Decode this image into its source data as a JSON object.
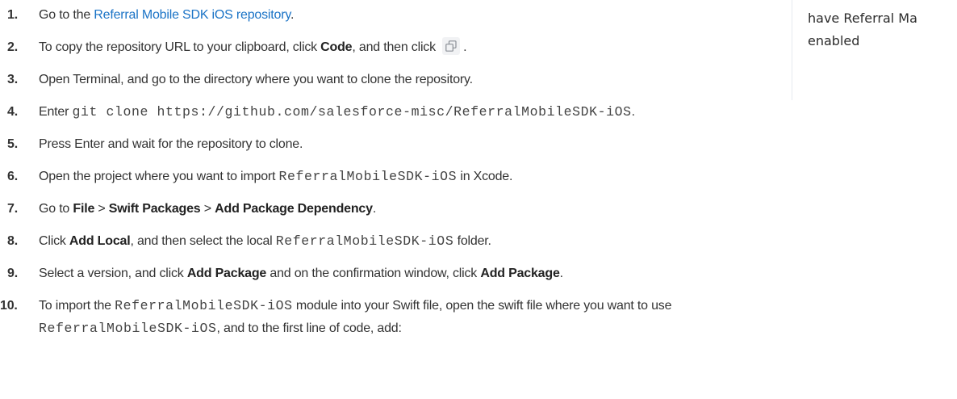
{
  "sidebar": {
    "text": "have Referral Ma",
    "text2": "enabled"
  },
  "steps": [
    {
      "num": "1.",
      "parts": [
        "Go to the ",
        "Referral Mobile SDK iOS repository",
        "."
      ]
    },
    {
      "num": "2.",
      "parts": [
        "To copy the repository URL to your clipboard, click ",
        "Code",
        ", and then click ",
        "."
      ]
    },
    {
      "num": "3.",
      "parts": [
        "Open Terminal, and go to the directory where you want to clone the repository."
      ]
    },
    {
      "num": "4.",
      "parts": [
        "Enter ",
        "git clone https://github.com/salesforce-misc/ReferralMobileSDK-iOS",
        "."
      ]
    },
    {
      "num": "5.",
      "parts": [
        "Press Enter and wait for the repository to clone."
      ]
    },
    {
      "num": "6.",
      "parts": [
        "Open the project where you want to import ",
        "ReferralMobileSDK-iOS",
        " in Xcode."
      ]
    },
    {
      "num": "7.",
      "parts": [
        "Go to ",
        "File",
        " > ",
        "Swift Packages",
        " > ",
        "Add Package Dependency",
        "."
      ]
    },
    {
      "num": "8.",
      "parts": [
        "Click ",
        "Add Local",
        ", and then select the local ",
        "ReferralMobileSDK-iOS",
        " folder."
      ]
    },
    {
      "num": "9.",
      "parts": [
        "Select a version, and click ",
        "Add Package",
        " and on the confirmation window, click ",
        "Add Package",
        "."
      ]
    },
    {
      "num": "10.",
      "parts": [
        "To import the ",
        "ReferralMobileSDK-iOS",
        " module into your Swift file, open the swift file where you want to use"
      ],
      "line2": [
        "ReferralMobileSDK-iOS",
        ", and to the first line of code, add:"
      ]
    }
  ],
  "icons": {
    "copy": "copy-icon"
  },
  "colors": {
    "link": "#1a73c6",
    "text": "#333333"
  }
}
